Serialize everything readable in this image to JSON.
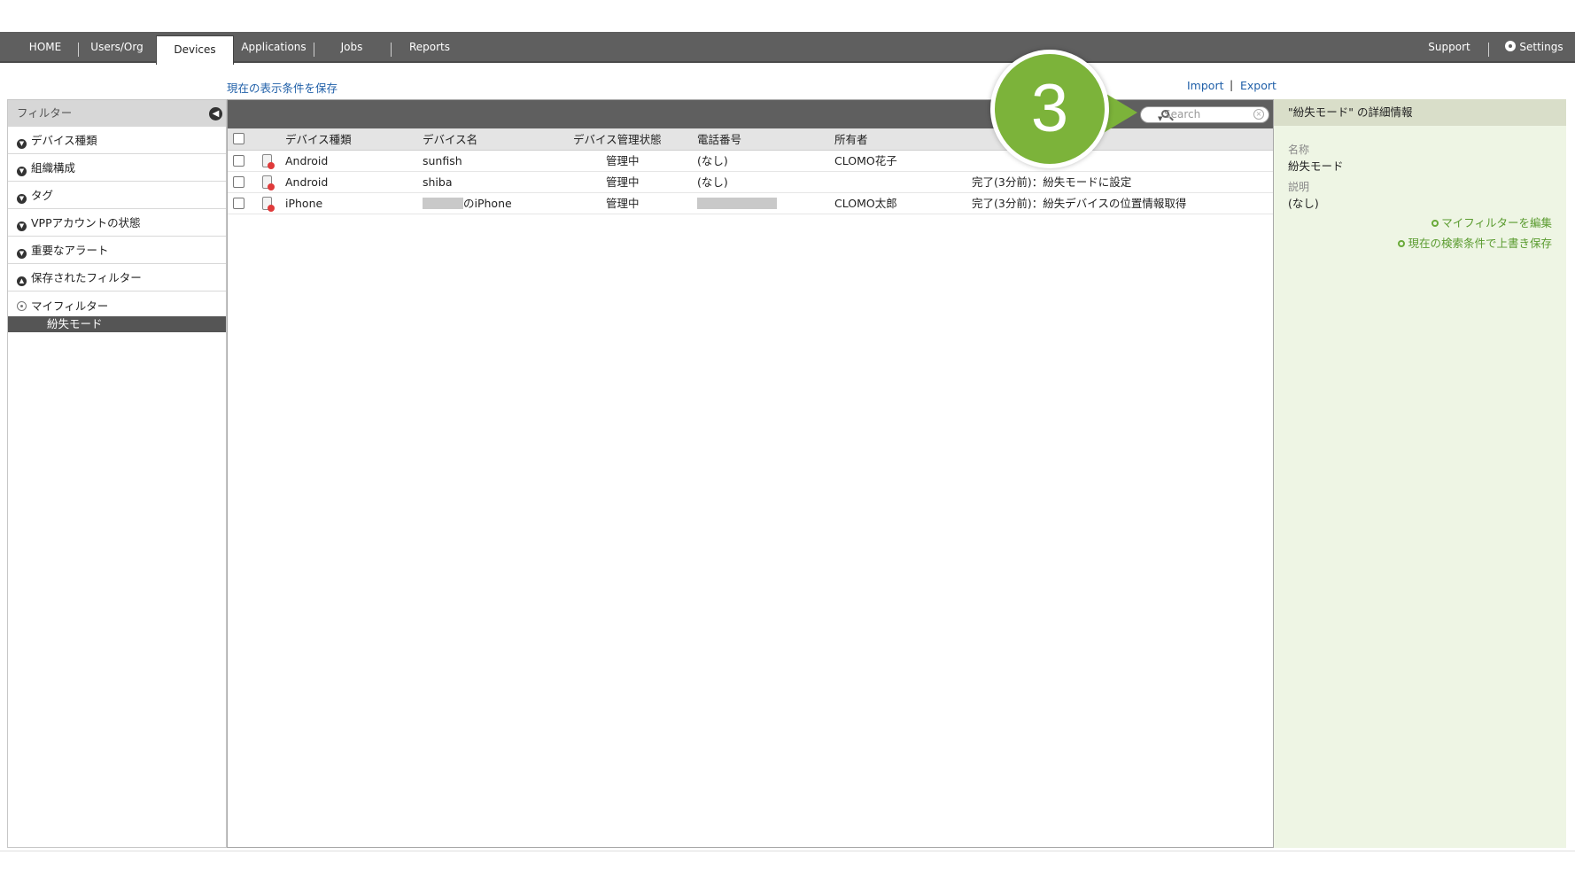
{
  "nav": {
    "tabs": [
      {
        "label": "HOME"
      },
      {
        "label": "Users/Org"
      },
      {
        "label": "Devices"
      },
      {
        "label": "Applications"
      },
      {
        "label": "Jobs"
      },
      {
        "label": "Reports"
      }
    ],
    "support_label": "Support",
    "settings_label": "Settings"
  },
  "toolbar": {
    "save_view_label": "現在の表示条件を保存",
    "import_label": "Import",
    "separator": "|",
    "export_label": "Export"
  },
  "sidebar": {
    "title": "フィルター",
    "items": [
      {
        "label": "デバイス種類"
      },
      {
        "label": "組織構成"
      },
      {
        "label": "タグ"
      },
      {
        "label": "VPPアカウントの状態"
      },
      {
        "label": "重要なアラート"
      },
      {
        "label": "保存されたフィルター"
      }
    ],
    "my_filter_label": "マイフィルター",
    "my_filter_selected": "紛失モード"
  },
  "search": {
    "placeholder": "Search"
  },
  "table": {
    "columns": [
      "デバイス種類",
      "デバイス名",
      "デバイス管理状態",
      "電話番号",
      "所有者"
    ],
    "rows": [
      {
        "type": "Android",
        "name": "sunfish",
        "status": "管理中",
        "phone": "(なし)",
        "owner": "CLOMO花子",
        "job": ""
      },
      {
        "type": "Android",
        "name": "shiba",
        "status": "管理中",
        "phone": "(なし)",
        "owner": "",
        "job": "完了(3分前)：紛失モードに設定"
      },
      {
        "type": "iPhone",
        "name": "のiPhone",
        "status": "管理中",
        "phone": "",
        "owner": "CLOMO太郎",
        "job": "完了(3分前)：紛失デバイスの位置情報取得"
      }
    ]
  },
  "details": {
    "title": "\"紛失モード\" の詳細情報",
    "name_label": "名称",
    "name_value": "紛失モード",
    "desc_label": "説明",
    "desc_value": "(なし)",
    "edit_link": "マイフィルターを編集",
    "overwrite_link": "現在の検索条件で上書き保存"
  },
  "callout": {
    "number": "3",
    "color": "#7cb33a"
  },
  "colors": {
    "nav_bg": "#5f5f5f",
    "link": "#1f5fa8",
    "details_bg": "#eef5e4",
    "details_link": "#5a9b2f"
  }
}
